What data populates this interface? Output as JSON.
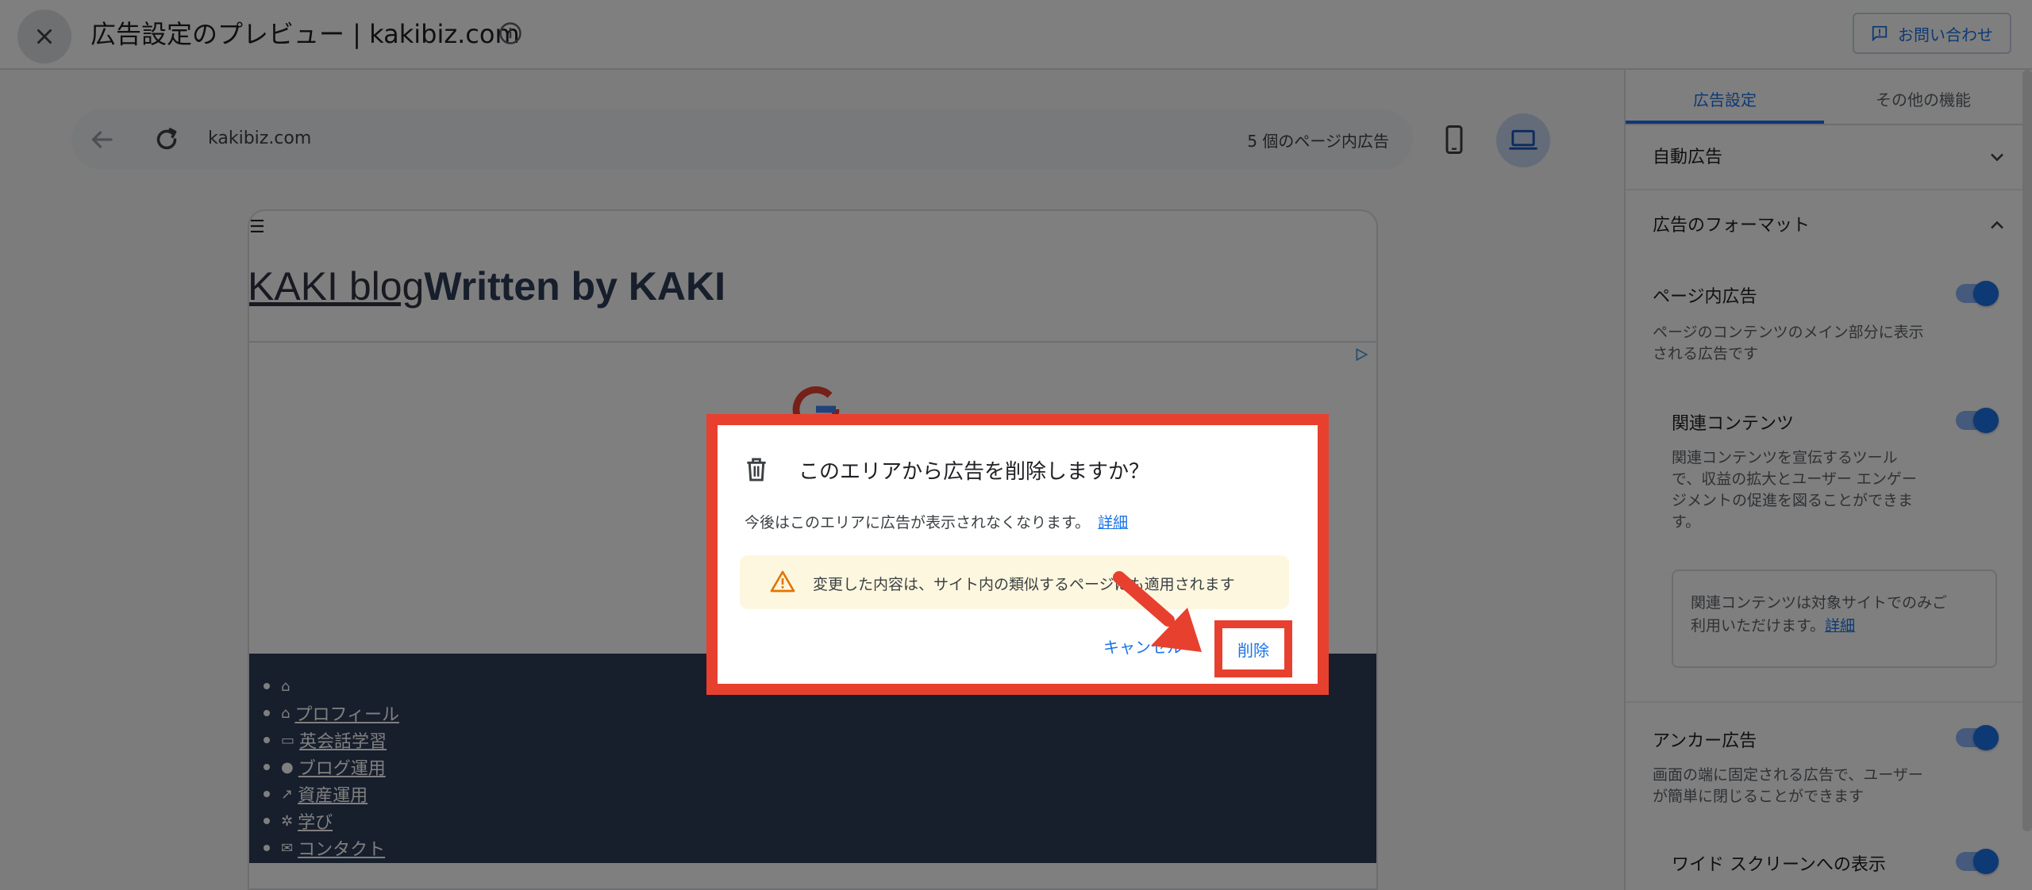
{
  "header": {
    "title": "広告設定のプレビュー | kakibiz.com",
    "contact_label": "お問い合わせ"
  },
  "browser": {
    "url": "kakibiz.com",
    "ad_count": "5 個のページ内広告"
  },
  "site": {
    "blog_link": "KAKI blog",
    "blog_strong": "Written by KAKI",
    "nav_items": [
      {
        "icon": "home-icon",
        "label": ""
      },
      {
        "icon": "home-icon",
        "label": " プロフィール"
      },
      {
        "icon": "book-icon",
        "label": "  英会話学習"
      },
      {
        "icon": "globe-icon",
        "label": " ブログ運用"
      },
      {
        "icon": "chart-icon",
        "label": " 資産運用"
      },
      {
        "icon": "spinner-icon",
        "label": " 学び"
      },
      {
        "icon": "envelope-icon",
        "label": " コンタクト"
      }
    ]
  },
  "panel": {
    "tabs": [
      "広告設定",
      "その他の機能"
    ],
    "auto_ads": "自動広告",
    "ad_formats": "広告のフォーマット",
    "in_page": {
      "label": "ページ内広告",
      "desc_line1": "ページのコンテンツのメイン部分に表示",
      "desc_line2": "される広告です",
      "on": true
    },
    "related": {
      "label": "関連コンテンツ",
      "desc_line1": "関連コンテンツを宣伝するツール",
      "desc_line2": "で、収益の拡大とユーザー エンゲー",
      "desc_line3": "ジメントの促進を図ることができま",
      "desc_line4": "す。",
      "on": true
    },
    "related_box_line1": "関連コンテンツは対象サイトでのみご",
    "related_box_line2": "利用いただけます。",
    "related_box_link": "詳細",
    "anchor": {
      "label": "アンカー広告",
      "desc_line1": "画面の端に固定される広告で、ユーザー",
      "desc_line2": "が簡単に閉じることができます",
      "on": true
    },
    "wide": {
      "label": "ワイド スクリーンへの表示",
      "on": true
    }
  },
  "dialog": {
    "title": "このエリアから広告を削除しますか？",
    "body": "今後はこのエリアに広告が表示されなくなります。",
    "body_link": "詳細",
    "warning": "変更した内容は、サイト内の類似するページにも適用されます",
    "cancel_label": "キャンセル",
    "delete_label": "削除"
  },
  "colors": {
    "accent": "#1a73e8",
    "highlight": "#e8402f",
    "site_nav": "#2e3d58",
    "warning_bg": "#fef7e0"
  }
}
